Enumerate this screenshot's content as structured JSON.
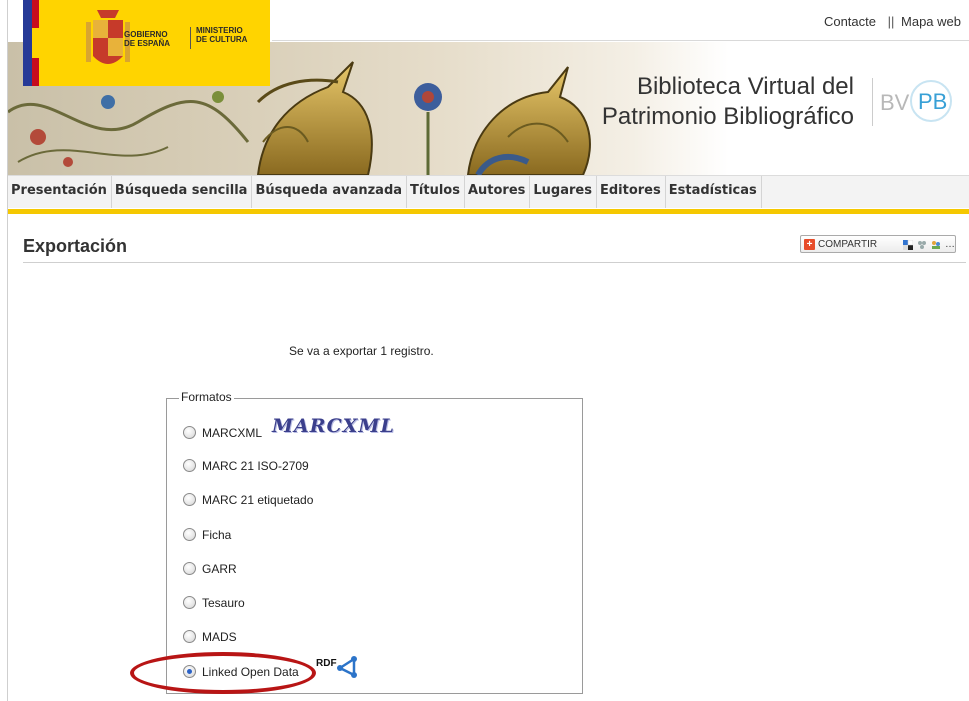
{
  "top_links": {
    "contact": "Contacte",
    "separator": "||",
    "sitemap": "Mapa web"
  },
  "gov_logo": {
    "line1": "GOBIERNO",
    "line2": "DE ESPAÑA",
    "ministry1": "MINISTERIO",
    "ministry2": "DE CULTURA"
  },
  "site_title": {
    "line1": "Biblioteca Virtual del",
    "line2": "Patrimonio Bibliográfico"
  },
  "bvpb_logo": {
    "left": "BV",
    "right": "PB"
  },
  "nav": {
    "items": [
      "Presentación",
      "Búsqueda sencilla",
      "Búsqueda avanzada",
      "Títulos",
      "Autores",
      "Lugares",
      "Editores",
      "Estadísticas"
    ]
  },
  "page": {
    "title": "Exportación",
    "share_label": "COMPARTIR",
    "message": "Se va a exportar 1 registro."
  },
  "formats": {
    "legend": "Formatos",
    "marcxml_badge": "MARCXML",
    "rdf_badge": "RDF",
    "options": [
      {
        "label": "MARCXML",
        "checked": false
      },
      {
        "label": "MARC 21 ISO-2709",
        "checked": false
      },
      {
        "label": "MARC 21 etiquetado",
        "checked": false
      },
      {
        "label": "Ficha",
        "checked": false
      },
      {
        "label": "GARR",
        "checked": false
      },
      {
        "label": "Tesauro",
        "checked": false
      },
      {
        "label": "MADS",
        "checked": false
      },
      {
        "label": "Linked Open Data",
        "checked": true
      }
    ]
  },
  "colors": {
    "nav_bar": "#f5c800",
    "highlight_ellipse": "#b81515",
    "gov_yellow": "#ffd400"
  },
  "icons": [
    "share-plus-icon",
    "delicious-icon",
    "network-icon",
    "people-icon",
    "rdf-graph-icon"
  ]
}
